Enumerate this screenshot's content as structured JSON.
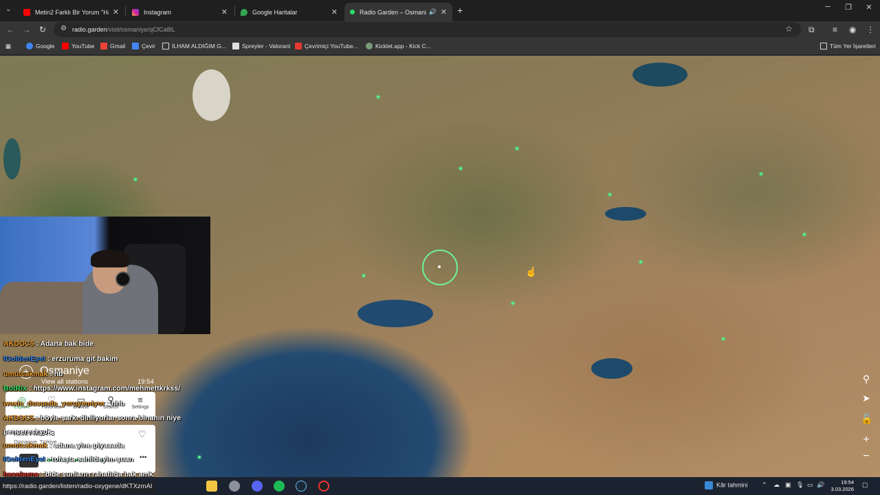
{
  "browser": {
    "tabs": [
      {
        "label": "Metin2 Farklı Bir Yorum \"Hadi G",
        "icon": "youtube-icon",
        "active": false
      },
      {
        "label": "Instagram",
        "icon": "instagram-icon",
        "active": false
      },
      {
        "label": "Google Haritalar",
        "icon": "maps-pin-icon",
        "active": false
      },
      {
        "label": "Radio Garden – Osmaniye",
        "icon": "radio-dot-icon",
        "active": true
      }
    ],
    "url_host": "radio.garden",
    "url_path": "/visit/osmaniye/qCfCa8lL",
    "bookmarks": [
      {
        "label": "Google",
        "icon": "google-icon"
      },
      {
        "label": "YouTube",
        "icon": "youtube-icon"
      },
      {
        "label": "Gmail",
        "icon": "gmail-icon"
      },
      {
        "label": "Çevir",
        "icon": "translate-icon"
      },
      {
        "label": "İLHAM ALDIĞIM G...",
        "icon": "folder-icon"
      },
      {
        "label": "Spreyler - Valorant",
        "icon": "valorant-icon"
      },
      {
        "label": "Çevrimiçi YouTube...",
        "icon": "tool-icon"
      },
      {
        "label": "Kicklet.app - Kick C...",
        "icon": "kicklet-icon"
      }
    ],
    "all_bookmarks": "Tüm Yer İşaretleri"
  },
  "radio_garden": {
    "city": "Osmaniye",
    "view_all": "View all stations",
    "time": "19:54",
    "nav": [
      {
        "label": "Explore",
        "icon": "explore-icon",
        "active": true
      },
      {
        "label": "Favorites",
        "icon": "heart-icon",
        "active": false
      },
      {
        "label": "Browse",
        "icon": "map-icon",
        "active": false
      },
      {
        "label": "Search",
        "icon": "search-icon",
        "active": false
      },
      {
        "label": "Settings",
        "icon": "menu-icon",
        "active": false
      }
    ],
    "station": "Kent FM 97.3",
    "location": "Osmaniye, Türkiye"
  },
  "chat": [
    {
      "user": "AKDOC5",
      "text": ": Adana bak bide",
      "color": "#f0a030"
    },
    {
      "user": "IGoldenEyeI",
      "text": ": erzuruma git bakim",
      "color": "#3a8af0"
    },
    {
      "user": "umutcakmak",
      "text": ": hb",
      "color": "#f0a030"
    },
    {
      "user": "BotRix",
      "text": ": https://www.instagram.com/mehmettkrkss/",
      "color": "#3adf6a"
    },
    {
      "user": "woxie_dusunde_yuruyemiyor",
      "text": ": hhb",
      "color": "#f0a030"
    },
    {
      "user": "AKDOC5",
      "text": ": böyle şarkı dinliyorlar sonra binanın niye",
      "color": "#f0a030"
    },
    {
      "user": "",
      "text": "penceresi yok",
      "color": "#ffffff"
    },
    {
      "user": "umutcakmak",
      "text": ": adana yine piyasada",
      "color": "#f0a030"
    },
    {
      "user": "IGoldenEyeI",
      "text": ": tofaşta sahildeyim şuan",
      "color": "#3a8af0"
    },
    {
      "user": "hesolayne",
      "text": ": bide şunların rahatlığa bak amk",
      "color": "#e03a3a"
    }
  ],
  "status_url": "https://radio.garden/listen/radio-oxygene/dKTXzmAI",
  "taskbar": {
    "weather": "Kâr tahmini",
    "time": "19:54",
    "date": "3.03.2026"
  }
}
